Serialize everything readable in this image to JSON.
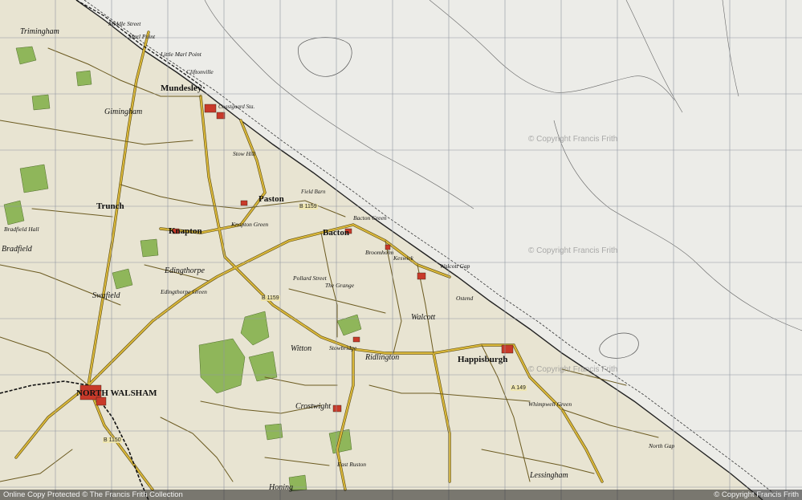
{
  "places": {
    "trimingham": "Trimingham",
    "mundesley": "Mundesley",
    "gimingham": "Gimingham",
    "paston": "Paston",
    "trunch": "Trunch",
    "knapton": "Knapton",
    "bacton": "Bacton",
    "bradfield": "Bradfield",
    "edingthorpe": "Edingthorpe",
    "swafield": "Swafield",
    "north_walsham": "NORTH WALSHAM",
    "witton": "Witton",
    "ridlington": "Ridlington",
    "walcott": "Walcott",
    "happisburgh": "Happisburgh",
    "crostwight": "Crostwight",
    "lessingham": "Lessingham",
    "middle_street": "Middle Street",
    "marl_point": "Marl Point",
    "little_marl_point": "Little Marl Point",
    "cliftonville": "Cliftonville",
    "stow_hill": "Stow Hill",
    "bacton_green": "Bacton Green",
    "keswick": "Keswick",
    "broomholm": "Broomholm",
    "the_grange": "The Grange",
    "pollard_street": "Pollard Street",
    "stowbridge": "Stowbridge",
    "walcott_gap": "Walcott Gap",
    "ostend": "Ostend",
    "whimpwell_green": "Whimpwell Green",
    "sea_palling_gap": "North Gap",
    "east_ruston": "East Ruston",
    "honing": "Honing",
    "knapton_green": "Knapton Green",
    "edingthorpe_green": "Edingthorpe Green",
    "bradfield_hall": "Bradfield Hall",
    "coast_guard_sta": "Coastguard Sta.",
    "field_dalling": "Field Barn"
  },
  "roads": {
    "b1159_a": "B 1159",
    "b1159_b": "B 1159",
    "b1150": "B 1150",
    "a149": "A 149"
  },
  "watermarks": [
    "© Copyright Francis Frith",
    "© Copyright Francis Frith",
    "© Copyright Francis Frith"
  ],
  "footer": {
    "left": "Online Copy Protected ©  The Francis Frith Collection",
    "right": "© Copyright Francis Frith"
  },
  "colors": {
    "land": "#e9e6d6",
    "sea": "#ecece8",
    "grid": "#9aa0a8",
    "road": "#d6b338",
    "road_edge": "#5a4a10",
    "wood": "#8fb65a",
    "coast": "#222"
  }
}
